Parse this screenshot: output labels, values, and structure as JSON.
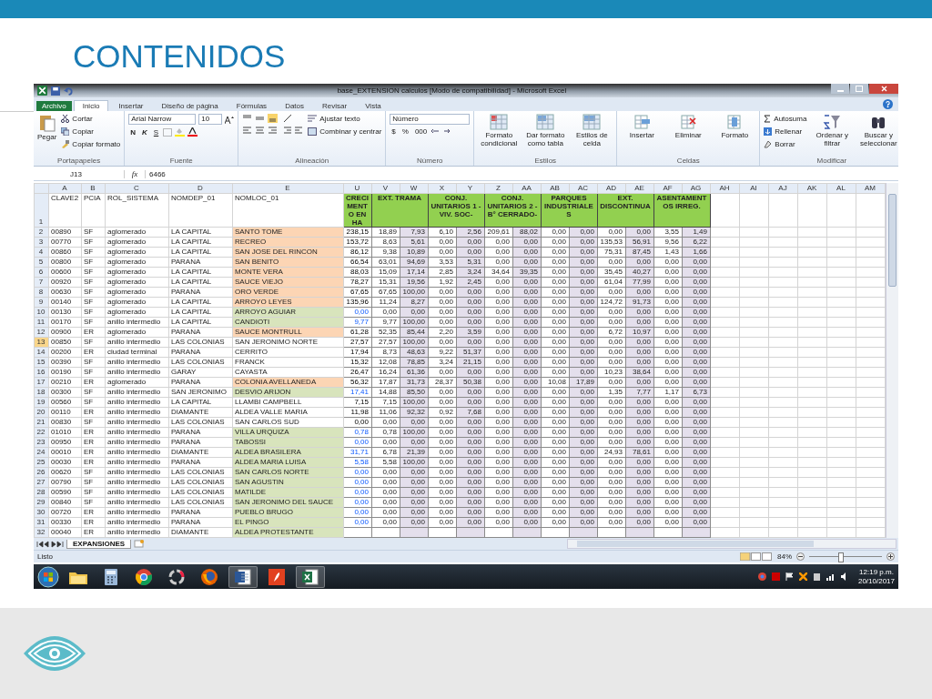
{
  "slide": {
    "title": "CONTENIDOS"
  },
  "window": {
    "title": "base_EXTENSION calculos  [Modo de compatibilidad] - Microsoft Excel"
  },
  "ribbon_tabs": [
    {
      "label": "Archivo",
      "kind": "file",
      "selected": false
    },
    {
      "label": "Inicio",
      "kind": "tab",
      "selected": true
    },
    {
      "label": "Insertar",
      "kind": "tab",
      "selected": false
    },
    {
      "label": "Diseño de página",
      "kind": "tab",
      "selected": false
    },
    {
      "label": "Fórmulas",
      "kind": "tab",
      "selected": false
    },
    {
      "label": "Datos",
      "kind": "tab",
      "selected": false
    },
    {
      "label": "Revisar",
      "kind": "tab",
      "selected": false
    },
    {
      "label": "Vista",
      "kind": "tab",
      "selected": false
    }
  ],
  "ribbon": {
    "clipboard": {
      "title": "Portapapeles",
      "paste": "Pegar",
      "cut": "Cortar",
      "copy": "Copiar",
      "format_painter": "Copiar formato"
    },
    "font": {
      "title": "Fuente",
      "font_name": "Arial Narrow",
      "font_size": "10",
      "bold": "N",
      "italic": "K",
      "underline": "S"
    },
    "alignment": {
      "title": "Alineación",
      "wrap_text": "Ajustar texto",
      "merge": "Combinar y centrar"
    },
    "number": {
      "title": "Número",
      "format": "Número",
      "currency": "$",
      "percent": "%",
      "thousands": "000"
    },
    "styles": {
      "title": "Estilos",
      "buttons": [
        "Formato condicional",
        "Dar formato como tabla",
        "Estilos de celda"
      ]
    },
    "cells": {
      "title": "Celdas",
      "buttons": [
        "Insertar",
        "Eliminar",
        "Formato"
      ]
    },
    "editing": {
      "title": "Modificar",
      "autosum": "Autosuma",
      "fill": "Rellenar",
      "clear": "Borrar",
      "buttons": [
        "Ordenar y filtrar",
        "Buscar y seleccionar"
      ]
    }
  },
  "formula_bar": {
    "name_box": "J13",
    "function_label": "fx",
    "value": "6466"
  },
  "sheet": {
    "column_letters": [
      "A",
      "B",
      "C",
      "D",
      "E",
      "U",
      "V",
      "W",
      "X",
      "Y",
      "Z",
      "AA",
      "AB",
      "AC",
      "AD",
      "AE",
      "AF",
      "AG",
      "AH",
      "AI",
      "AJ",
      "AK",
      "AL",
      "AM"
    ],
    "header_row_number": "1",
    "field_headers": [
      "CLAVE2",
      "PCIA",
      "ROL_SISTEMA",
      "NOMDEP_01",
      "NOMLOC_01"
    ],
    "group_headers": [
      "CRECIMENTO EN HA",
      "EXT. TRAMA",
      "CONJ. UNITARIOS 1 - VIV. SOC-",
      "CONJ. UNITARIOS 2 - B° CERRADO-",
      "PARQUES INDUSTRIALES",
      "EXT. DISCONTINUA",
      "ASENTAMENTOS IRREG."
    ],
    "rows": [
      {
        "n": "2",
        "selected": false,
        "color": "#fcd5b4",
        "blue_value": false,
        "cells": [
          "00890",
          "SF",
          "aglomerado",
          "LA CAPITAL",
          "SANTO TOME"
        ],
        "values": [
          "238,15",
          "18,89",
          "7,93",
          "6,10",
          "2,56",
          "209,61",
          "88,02",
          "0,00",
          "0,00",
          "0,00",
          "0,00",
          "3,55",
          "1,49"
        ]
      },
      {
        "n": "3",
        "selected": false,
        "color": "#fcd5b4",
        "blue_value": false,
        "cells": [
          "00770",
          "SF",
          "aglomerado",
          "LA CAPITAL",
          "RECREO"
        ],
        "values": [
          "153,72",
          "8,63",
          "5,61",
          "0,00",
          "0,00",
          "0,00",
          "0,00",
          "0,00",
          "0,00",
          "135,53",
          "56,91",
          "9,56",
          "6,22"
        ]
      },
      {
        "n": "4",
        "selected": false,
        "color": "#fcd5b4",
        "blue_value": false,
        "cells": [
          "00860",
          "SF",
          "aglomerado",
          "LA CAPITAL",
          "SAN JOSE DEL RINCON"
        ],
        "values": [
          "86,12",
          "9,38",
          "10,89",
          "0,00",
          "0,00",
          "0,00",
          "0,00",
          "0,00",
          "0,00",
          "75,31",
          "87,45",
          "1,43",
          "1,66"
        ]
      },
      {
        "n": "5",
        "selected": false,
        "color": "#fcd5b4",
        "blue_value": false,
        "cells": [
          "00800",
          "SF",
          "aglomerado",
          "PARANA",
          "SAN BENITO"
        ],
        "values": [
          "66,54",
          "63,01",
          "94,69",
          "3,53",
          "5,31",
          "0,00",
          "0,00",
          "0,00",
          "0,00",
          "0,00",
          "0,00",
          "0,00",
          "0,00"
        ]
      },
      {
        "n": "6",
        "selected": false,
        "color": "#fcd5b4",
        "blue_value": false,
        "cells": [
          "00600",
          "SF",
          "aglomerado",
          "LA CAPITAL",
          "MONTE VERA"
        ],
        "values": [
          "88,03",
          "15,09",
          "17,14",
          "2,85",
          "3,24",
          "34,64",
          "39,35",
          "0,00",
          "0,00",
          "35,45",
          "40,27",
          "0,00",
          "0,00"
        ]
      },
      {
        "n": "7",
        "selected": false,
        "color": "#fcd5b4",
        "blue_value": false,
        "cells": [
          "00920",
          "SF",
          "aglomerado",
          "LA CAPITAL",
          "SAUCE VIEJO"
        ],
        "values": [
          "78,27",
          "15,31",
          "19,56",
          "1,92",
          "2,45",
          "0,00",
          "0,00",
          "0,00",
          "0,00",
          "61,04",
          "77,99",
          "0,00",
          "0,00"
        ]
      },
      {
        "n": "8",
        "selected": false,
        "color": "#fcd5b4",
        "blue_value": false,
        "cells": [
          "00630",
          "SF",
          "aglomerado",
          "PARANA",
          "ORO VERDE"
        ],
        "values": [
          "67,65",
          "67,65",
          "100,00",
          "0,00",
          "0,00",
          "0,00",
          "0,00",
          "0,00",
          "0,00",
          "0,00",
          "0,00",
          "0,00",
          "0,00"
        ]
      },
      {
        "n": "9",
        "selected": false,
        "color": "#fcd5b4",
        "blue_value": false,
        "cells": [
          "00140",
          "SF",
          "aglomerado",
          "LA CAPITAL",
          "ARROYO LEYES"
        ],
        "values": [
          "135,96",
          "11,24",
          "8,27",
          "0,00",
          "0,00",
          "0,00",
          "0,00",
          "0,00",
          "0,00",
          "124,72",
          "91,73",
          "0,00",
          "0,00"
        ]
      },
      {
        "n": "10",
        "selected": false,
        "color": "#d8e4bc",
        "blue_value": true,
        "cells": [
          "00130",
          "SF",
          "aglomerado",
          "LA CAPITAL",
          "ARROYO AGUIAR"
        ],
        "values": [
          "0,00",
          "0,00",
          "0,00",
          "0,00",
          "0,00",
          "0,00",
          "0,00",
          "0,00",
          "0,00",
          "0,00",
          "0,00",
          "0,00",
          "0,00"
        ]
      },
      {
        "n": "11",
        "selected": false,
        "color": "#d8e4bc",
        "blue_value": true,
        "cells": [
          "00170",
          "SF",
          "anillo intermedio",
          "LA CAPITAL",
          "CANDIOTI"
        ],
        "values": [
          "9,77",
          "9,77",
          "100,00",
          "0,00",
          "0,00",
          "0,00",
          "0,00",
          "0,00",
          "0,00",
          "0,00",
          "0,00",
          "0,00",
          "0,00"
        ]
      },
      {
        "n": "12",
        "selected": false,
        "color": "#fcd5b4",
        "blue_value": false,
        "cells": [
          "00900",
          "ER",
          "aglomerado",
          "PARANA",
          "SAUCE MONTRULL"
        ],
        "values": [
          "61,28",
          "52,35",
          "85,44",
          "2,20",
          "3,59",
          "0,00",
          "0,00",
          "0,00",
          "0,00",
          "6,72",
          "10,97",
          "0,00",
          "0,00"
        ]
      },
      {
        "n": "13",
        "selected": true,
        "color": "#ffffff",
        "blue_value": false,
        "cells": [
          "00850",
          "SF",
          "anillo intermedio",
          "LAS COLONIAS",
          "SAN JERONIMO NORTE"
        ],
        "values": [
          "27,57",
          "27,57",
          "100,00",
          "0,00",
          "0,00",
          "0,00",
          "0,00",
          "0,00",
          "0,00",
          "0,00",
          "0,00",
          "0,00",
          "0,00"
        ]
      },
      {
        "n": "14",
        "selected": false,
        "color": "#ffffff",
        "blue_value": false,
        "cells": [
          "00200",
          "ER",
          "ciudad terminal",
          "PARANA",
          "CERRITO"
        ],
        "values": [
          "17,94",
          "8,73",
          "48,63",
          "9,22",
          "51,37",
          "0,00",
          "0,00",
          "0,00",
          "0,00",
          "0,00",
          "0,00",
          "0,00",
          "0,00"
        ]
      },
      {
        "n": "15",
        "selected": false,
        "color": "#ffffff",
        "blue_value": false,
        "cells": [
          "00390",
          "SF",
          "anillo intermedio",
          "LAS COLONIAS",
          "FRANCK"
        ],
        "values": [
          "15,32",
          "12,08",
          "78,85",
          "3,24",
          "21,15",
          "0,00",
          "0,00",
          "0,00",
          "0,00",
          "0,00",
          "0,00",
          "0,00",
          "0,00"
        ]
      },
      {
        "n": "16",
        "selected": false,
        "color": "#ffffff",
        "blue_value": false,
        "cells": [
          "00190",
          "SF",
          "anillo intermedio",
          "GARAY",
          "CAYASTA"
        ],
        "values": [
          "26,47",
          "16,24",
          "61,36",
          "0,00",
          "0,00",
          "0,00",
          "0,00",
          "0,00",
          "0,00",
          "10,23",
          "38,64",
          "0,00",
          "0,00"
        ]
      },
      {
        "n": "17",
        "selected": false,
        "color": "#fcd5b4",
        "blue_value": false,
        "cells": [
          "00210",
          "ER",
          "aglomerado",
          "PARANA",
          "COLONIA AVELLANEDA"
        ],
        "values": [
          "56,32",
          "17,87",
          "31,73",
          "28,37",
          "50,38",
          "0,00",
          "0,00",
          "10,08",
          "17,89",
          "0,00",
          "0,00",
          "0,00",
          "0,00"
        ]
      },
      {
        "n": "18",
        "selected": false,
        "color": "#d8e4bc",
        "blue_value": true,
        "cells": [
          "00300",
          "SF",
          "anillo intermedio",
          "SAN JERONIMO",
          "DESVIO ARIJON"
        ],
        "values": [
          "17,41",
          "14,88",
          "85,50",
          "0,00",
          "0,00",
          "0,00",
          "0,00",
          "0,00",
          "0,00",
          "1,35",
          "7,77",
          "1,17",
          "6,73"
        ]
      },
      {
        "n": "19",
        "selected": false,
        "color": "#ffffff",
        "blue_value": false,
        "cells": [
          "00560",
          "SF",
          "anillo intermedio",
          "LA CAPITAL",
          "LLAMBI CAMPBELL"
        ],
        "values": [
          "7,15",
          "7,15",
          "100,00",
          "0,00",
          "0,00",
          "0,00",
          "0,00",
          "0,00",
          "0,00",
          "0,00",
          "0,00",
          "0,00",
          "0,00"
        ]
      },
      {
        "n": "20",
        "selected": false,
        "color": "#ffffff",
        "blue_value": false,
        "cells": [
          "00110",
          "ER",
          "anillo intermedio",
          "DIAMANTE",
          "ALDEA VALLE MARIA"
        ],
        "values": [
          "11,98",
          "11,06",
          "92,32",
          "0,92",
          "7,68",
          "0,00",
          "0,00",
          "0,00",
          "0,00",
          "0,00",
          "0,00",
          "0,00",
          "0,00"
        ]
      },
      {
        "n": "21",
        "selected": false,
        "color": "#ffffff",
        "blue_value": false,
        "cells": [
          "00830",
          "SF",
          "anillo intermedio",
          "LAS COLONIAS",
          "SAN CARLOS SUD"
        ],
        "values": [
          "0,00",
          "0,00",
          "0,00",
          "0,00",
          "0,00",
          "0,00",
          "0,00",
          "0,00",
          "0,00",
          "0,00",
          "0,00",
          "0,00",
          "0,00"
        ]
      },
      {
        "n": "22",
        "selected": false,
        "color": "#d8e4bc",
        "blue_value": true,
        "cells": [
          "01010",
          "ER",
          "anillo intermedio",
          "PARANA",
          "VILLA URQUIZA"
        ],
        "values": [
          "0,78",
          "0,78",
          "100,00",
          "0,00",
          "0,00",
          "0,00",
          "0,00",
          "0,00",
          "0,00",
          "0,00",
          "0,00",
          "0,00",
          "0,00"
        ]
      },
      {
        "n": "23",
        "selected": false,
        "color": "#d8e4bc",
        "blue_value": true,
        "cells": [
          "00950",
          "ER",
          "anillo intermedio",
          "PARANA",
          "TABOSSI"
        ],
        "values": [
          "0,00",
          "0,00",
          "0,00",
          "0,00",
          "0,00",
          "0,00",
          "0,00",
          "0,00",
          "0,00",
          "0,00",
          "0,00",
          "0,00",
          "0,00"
        ]
      },
      {
        "n": "24",
        "selected": false,
        "color": "#d8e4bc",
        "blue_value": true,
        "cells": [
          "00010",
          "ER",
          "anillo intermedio",
          "DIAMANTE",
          "ALDEA BRASILERA"
        ],
        "values": [
          "31,71",
          "6,78",
          "21,39",
          "0,00",
          "0,00",
          "0,00",
          "0,00",
          "0,00",
          "0,00",
          "24,93",
          "78,61",
          "0,00",
          "0,00"
        ]
      },
      {
        "n": "25",
        "selected": false,
        "color": "#d8e4bc",
        "blue_value": true,
        "cells": [
          "00030",
          "ER",
          "anillo intermedio",
          "PARANA",
          "ALDEA MARIA LUISA"
        ],
        "values": [
          "5,58",
          "5,58",
          "100,00",
          "0,00",
          "0,00",
          "0,00",
          "0,00",
          "0,00",
          "0,00",
          "0,00",
          "0,00",
          "0,00",
          "0,00"
        ]
      },
      {
        "n": "26",
        "selected": false,
        "color": "#d8e4bc",
        "blue_value": true,
        "cells": [
          "00620",
          "SF",
          "anillo intermedio",
          "LAS COLONIAS",
          "SAN CARLOS NORTE"
        ],
        "values": [
          "0,00",
          "0,00",
          "0,00",
          "0,00",
          "0,00",
          "0,00",
          "0,00",
          "0,00",
          "0,00",
          "0,00",
          "0,00",
          "0,00",
          "0,00"
        ]
      },
      {
        "n": "27",
        "selected": false,
        "color": "#d8e4bc",
        "blue_value": true,
        "cells": [
          "00790",
          "SF",
          "anillo intermedio",
          "LAS COLONIAS",
          "SAN AGUSTIN"
        ],
        "values": [
          "0,00",
          "0,00",
          "0,00",
          "0,00",
          "0,00",
          "0,00",
          "0,00",
          "0,00",
          "0,00",
          "0,00",
          "0,00",
          "0,00",
          "0,00"
        ]
      },
      {
        "n": "28",
        "selected": false,
        "color": "#d8e4bc",
        "blue_value": true,
        "cells": [
          "00590",
          "SF",
          "anillo intermedio",
          "LAS COLONIAS",
          "MATILDE"
        ],
        "values": [
          "0,00",
          "0,00",
          "0,00",
          "0,00",
          "0,00",
          "0,00",
          "0,00",
          "0,00",
          "0,00",
          "0,00",
          "0,00",
          "0,00",
          "0,00"
        ]
      },
      {
        "n": "29",
        "selected": false,
        "color": "#d8e4bc",
        "blue_value": true,
        "cells": [
          "00840",
          "SF",
          "anillo intermedio",
          "LAS COLONIAS",
          "SAN JERONIMO DEL SAUCE"
        ],
        "values": [
          "0,00",
          "0,00",
          "0,00",
          "0,00",
          "0,00",
          "0,00",
          "0,00",
          "0,00",
          "0,00",
          "0,00",
          "0,00",
          "0,00",
          "0,00"
        ]
      },
      {
        "n": "30",
        "selected": false,
        "color": "#d8e4bc",
        "blue_value": true,
        "cells": [
          "00720",
          "ER",
          "anillo intermedio",
          "PARANA",
          "PUEBLO BRUGO"
        ],
        "values": [
          "0,00",
          "0,00",
          "0,00",
          "0,00",
          "0,00",
          "0,00",
          "0,00",
          "0,00",
          "0,00",
          "0,00",
          "0,00",
          "0,00",
          "0,00"
        ]
      },
      {
        "n": "31",
        "selected": false,
        "color": "#d8e4bc",
        "blue_value": true,
        "cells": [
          "00330",
          "ER",
          "anillo intermedio",
          "PARANA",
          "EL PINGO"
        ],
        "values": [
          "0,00",
          "0,00",
          "0,00",
          "0,00",
          "0,00",
          "0,00",
          "0,00",
          "0,00",
          "0,00",
          "0,00",
          "0,00",
          "0,00",
          "0,00"
        ]
      },
      {
        "n": "32",
        "selected": false,
        "color": "#d8e4bc",
        "cells": [
          "00040",
          "ER",
          "anillo intermedio",
          "DIAMANTE",
          "ALDEA PROTESTANTE"
        ]
      }
    ]
  },
  "sheet_tabs": [
    {
      "label": "EXPANSIONES",
      "selected": true
    }
  ],
  "status_bar": {
    "text": "Listo",
    "zoom": "84%",
    "level": 0.42
  },
  "taskbar": {
    "time": "12:19 p.m.",
    "date": "20/10/2017"
  }
}
